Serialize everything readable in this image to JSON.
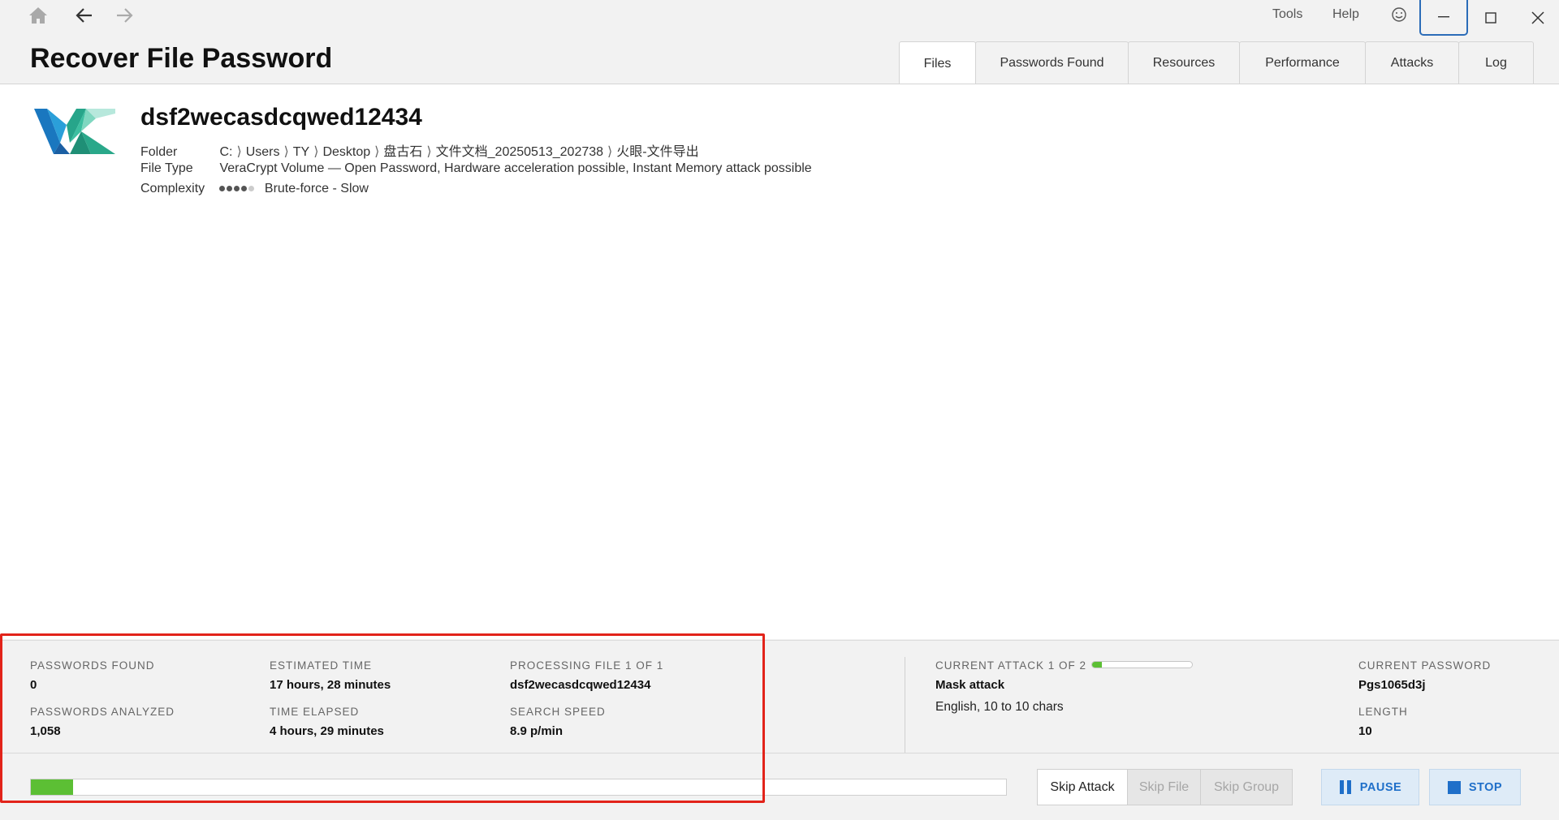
{
  "titlebar": {
    "icons": {
      "home": "home-icon",
      "back": "arrow-left-icon",
      "forward": "arrow-right-icon",
      "feedback": "smiley-icon",
      "minimize": "minimize-icon",
      "maximize": "maximize-icon",
      "close": "close-icon"
    },
    "menu": {
      "tools": "Tools",
      "help": "Help"
    }
  },
  "header": {
    "title": "Recover File Password",
    "tabs": [
      {
        "label": "Files",
        "active": true
      },
      {
        "label": "Passwords Found",
        "active": false
      },
      {
        "label": "Resources",
        "active": false
      },
      {
        "label": "Performance",
        "active": false
      },
      {
        "label": "Attacks",
        "active": false
      },
      {
        "label": "Log",
        "active": false
      }
    ]
  },
  "file": {
    "logo": "veracrypt-logo-icon",
    "name": "dsf2wecasdcqwed12434",
    "folder_label": "Folder",
    "folder_path": [
      "C:",
      "Users",
      "TY",
      "Desktop",
      "盘古石",
      "文件文档_20250513_202738",
      "火眼-文件导出"
    ],
    "folder_separator": "⟩",
    "type_label": "File Type",
    "type_value": "VeraCrypt Volume — Open Password, Hardware acceleration possible, Instant Memory attack possible",
    "complexity_label": "Complexity",
    "complexity_level": 4,
    "complexity_max": 5,
    "complexity_text": "Brute-force - Slow"
  },
  "stats": {
    "passwords_found_label": "PASSWORDS FOUND",
    "passwords_found": "0",
    "passwords_analyzed_label": "PASSWORDS ANALYZED",
    "passwords_analyzed": "1,058",
    "estimated_time_label": "ESTIMATED TIME",
    "estimated_time": "17 hours, 28 minutes",
    "time_elapsed_label": "TIME ELAPSED",
    "time_elapsed": "4 hours, 29 minutes",
    "processing_label": "PROCESSING FILE 1 OF 1",
    "processing_file": "dsf2wecasdcqwed12434",
    "search_speed_label": "SEARCH SPEED",
    "search_speed": "8.9 p/min",
    "current_attack_label": "CURRENT ATTACK 1 OF 2",
    "attack_progress": 0.1,
    "attack_name": "Mask attack",
    "attack_detail": "English, 10 to 10 chars",
    "current_password_label": "CURRENT PASSWORD",
    "current_password": "Pgs1065d3j",
    "length_label": "LENGTH",
    "length": "10",
    "overall_progress": 0.043
  },
  "actions": {
    "skip_attack": "Skip Attack",
    "skip_file": "Skip File",
    "skip_group": "Skip Group",
    "pause": "PAUSE",
    "stop": "STOP",
    "pause_icon": "pause-icon",
    "stop_icon": "stop-icon"
  },
  "colors": {
    "accent": "#1f6fc9",
    "progress": "#5cbf34",
    "highlight_annotation": "#e2231a"
  }
}
